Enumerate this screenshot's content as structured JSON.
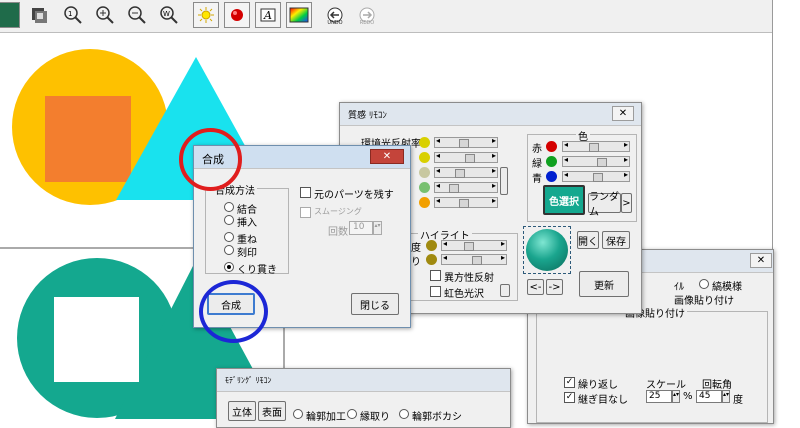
{
  "toolbar": {
    "undo_label": "UNDO",
    "redo_label": "REDO"
  },
  "colors": {
    "yellow": "#fec100",
    "orange": "#f37e2e",
    "cyan": "#19e2ee",
    "teal": "#14a88f",
    "annotation_red": "#e01d1d",
    "annotation_blue": "#1c27d6"
  },
  "gousei": {
    "title": "合成",
    "close": "✕",
    "method_group": "合成方法",
    "radios": [
      "結合",
      "挿入",
      "重ね",
      "刻印",
      "くり貫き"
    ],
    "selected": "くり貫き",
    "keep_parts": "元のパーツを残す",
    "smoothing": "スムージング",
    "count_label": "回数",
    "count_value": "10",
    "ok_button": "合成",
    "close_button": "閉じる"
  },
  "shitsukan": {
    "title": "質感 ﾘﾓｺﾝ",
    "close": "✕",
    "ambient": "環境光反射率",
    "color_group": "色",
    "red": "赤",
    "green": "緑",
    "blue": "青",
    "color_select": "色選択",
    "random": "ランダム",
    "random_arrow": ">",
    "highlight_group": "ハイライト",
    "hl_row1": "度",
    "hl_row2": "り",
    "anisotropic": "異方性反射",
    "iridescent": "虹色光沢",
    "open": "開く",
    "save": "保存",
    "prev": "<-",
    "next": "->",
    "update": "更新"
  },
  "texture": {
    "close": "✕",
    "opt_left": "ｲﾙ",
    "opt_stripe": "縞模様",
    "image_paste": "画像貼り付け",
    "image_paste_group": "画像貼り付け",
    "repeat": "繰り返し",
    "seamless": "継ぎ目なし",
    "scale_label": "スケール",
    "scale_value": "25",
    "scale_unit": "%",
    "rotation_label": "回転角",
    "rotation_value": "45",
    "rotation_unit": "度"
  },
  "modeling": {
    "title": "ﾓﾃﾞﾘﾝｸﾞ ﾘﾓｺﾝ",
    "tab_solid": "立体",
    "tab_surface": "表面",
    "opt1": "輪郭加工",
    "opt2": "縁取り",
    "opt3": "輪郭ボカシ"
  }
}
